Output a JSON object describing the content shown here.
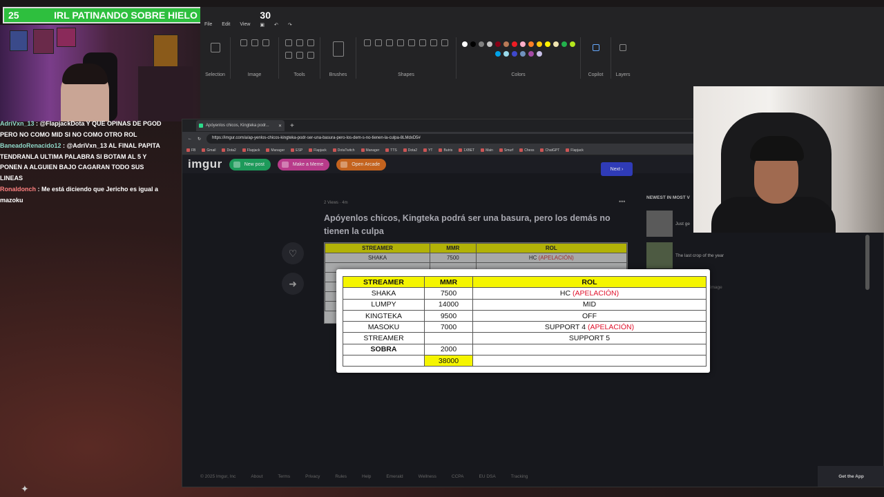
{
  "goal": {
    "start": "25",
    "title": "IRL PATINANDO SOBRE HIELO",
    "end": "30",
    "progress_fraction": 0.83
  },
  "chat": [
    {
      "user": "AdriVxn_13",
      "text": " : @FlapjackDota Y QUE OPINAS DE PGOD PERO NO COMO MID SI NO COMO OTRO ROL"
    },
    {
      "user": "BaneadoRenacido12",
      "text": " : @AdriVxn_13 AL FINAL PAPITA TENDRANLA ULTIMA PALABRA SI BOTAM AL 5 Y PONEN A ALGUIEN BAJO CAGARAN TODO SUS LINEAS"
    },
    {
      "user": "Ronaldonch",
      "text": " : Me está diciendo que Jericho es igual a mazoku"
    }
  ],
  "paint": {
    "menus": [
      "File",
      "Edit",
      "View"
    ],
    "groups": [
      "Selection",
      "Image",
      "Tools",
      "Brushes",
      "Shapes",
      "Colors",
      "Copilot",
      "Layers"
    ],
    "colors": [
      "#ffffff",
      "#000000",
      "#7f7f7f",
      "#c3c3c3",
      "#880015",
      "#b97a57",
      "#ed1c24",
      "#ffaec9",
      "#ff7f27",
      "#ffc90e",
      "#fff200",
      "#efe4b0",
      "#22b14c",
      "#b5e61d",
      "#00a2e8",
      "#99d9ea",
      "#3f48cc",
      "#7092be",
      "#a349a4",
      "#c8bfe7"
    ]
  },
  "browser": {
    "tab_title": "Apóyenlos chicos, Kingteka podr...",
    "url": "https://imgur.com/a/ap-yenlos-chicos-kingteka-podr-ser-una-basura-pero-los-dem-s-no-tienen-la-culpa-8LMdxD5#",
    "bookmarks": [
      "FB",
      "Gmail",
      "Dota2",
      "Flapjack",
      "Manager",
      "ESP",
      "Flapjack",
      "DotaTwitch",
      "Manager",
      "TTS",
      "Dota2",
      "YT",
      "Butris",
      "1XBET",
      "Main",
      "Smurf",
      "Chess",
      "ChatGPT",
      "Flapjack"
    ]
  },
  "imgur": {
    "logo": "imgur",
    "new_post": "New post",
    "make_meme": "Make a Meme",
    "open_arcade": "Open Arcade",
    "next": "Next",
    "meta": "2 Views · 4m",
    "title": "Apóyenlos chicos, Kingteka podrá ser una basura, pero los demás no tienen la culpa",
    "newest": "NEWEST IN MOST V",
    "side_posts": [
      "Just ge",
      "The last crop of the year",
      "image"
    ],
    "footer": [
      "© 2025 Imgur, Inc",
      "About",
      "Terms",
      "Privacy",
      "Rules",
      "Help",
      "Emerald",
      "Wellness",
      "CCPA",
      "EU DSA",
      "Tracking"
    ],
    "get_app": "Get the App"
  },
  "table": {
    "headers": [
      "STREAMER",
      "MMR",
      "ROL"
    ],
    "rows": [
      {
        "streamer": "SHAKA",
        "mmr": "7500",
        "rol": "HC ",
        "note": "(APELACIÓN)"
      },
      {
        "streamer": "LUMPY",
        "mmr": "14000",
        "rol": "MID",
        "note": ""
      },
      {
        "streamer": "KINGTEKA",
        "mmr": "9500",
        "rol": "OFF",
        "note": ""
      },
      {
        "streamer": "MASOKU",
        "mmr": "7000",
        "rol": "SUPPORT 4 ",
        "note": "(APELACIÓN)"
      },
      {
        "streamer": "STREAMER",
        "mmr": "",
        "rol": "SUPPORT 5",
        "note": ""
      },
      {
        "streamer": "SOBRA",
        "mmr": "2000",
        "rol": "",
        "note": ""
      }
    ],
    "total": "38000"
  }
}
